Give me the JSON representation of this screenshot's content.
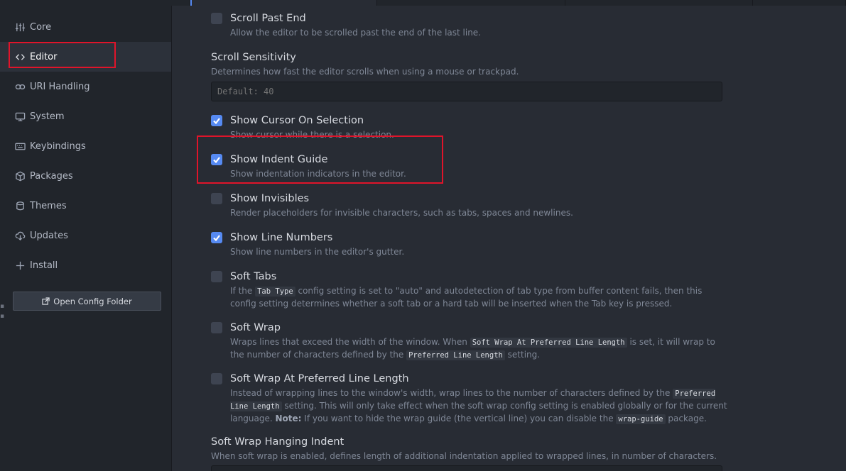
{
  "sidebar": {
    "items": [
      {
        "label": "Core",
        "icon": "sliders-icon"
      },
      {
        "label": "Editor",
        "icon": "code-icon"
      },
      {
        "label": "URI Handling",
        "icon": "link-icon"
      },
      {
        "label": "System",
        "icon": "monitor-icon"
      },
      {
        "label": "Keybindings",
        "icon": "keyboard-icon"
      },
      {
        "label": "Packages",
        "icon": "package-icon"
      },
      {
        "label": "Themes",
        "icon": "paintcan-icon"
      },
      {
        "label": "Updates",
        "icon": "cloud-download-icon"
      },
      {
        "label": "Install",
        "icon": "plus-icon"
      }
    ],
    "selected": "Editor",
    "open_config_label": "Open Config Folder"
  },
  "settings": {
    "scroll_past_end": {
      "title": "Scroll Past End",
      "desc": "Allow the editor to be scrolled past the end of the last line.",
      "checked": false
    },
    "scroll_sensitivity": {
      "title": "Scroll Sensitivity",
      "desc": "Determines how fast the editor scrolls when using a mouse or trackpad.",
      "placeholder": "Default: 40"
    },
    "show_cursor_on_selection": {
      "title": "Show Cursor On Selection",
      "desc": "Show cursor while there is a selection.",
      "checked": true
    },
    "show_indent_guide": {
      "title": "Show Indent Guide",
      "desc": "Show indentation indicators in the editor.",
      "checked": true
    },
    "show_invisibles": {
      "title": "Show Invisibles",
      "desc": "Render placeholders for invisible characters, such as tabs, spaces and newlines.",
      "checked": false
    },
    "show_line_numbers": {
      "title": "Show Line Numbers",
      "desc": "Show line numbers in the editor's gutter.",
      "checked": true
    },
    "soft_tabs": {
      "title": "Soft Tabs",
      "desc_1": "If the ",
      "code_1": "Tab Type",
      "desc_2": " config setting is set to \"auto\" and autodetection of tab type from buffer content fails, then this config setting determines whether a soft tab or a hard tab will be inserted when the Tab key is pressed.",
      "checked": false
    },
    "soft_wrap": {
      "title": "Soft Wrap",
      "desc_1": "Wraps lines that exceed the width of the window. When ",
      "code_1": "Soft Wrap At Preferred Line Length",
      "desc_2": " is set, it will wrap to the number of characters defined by the ",
      "code_2": "Preferred Line Length",
      "desc_3": " setting.",
      "checked": false
    },
    "soft_wrap_at_preferred": {
      "title": "Soft Wrap At Preferred Line Length",
      "desc_1": "Instead of wrapping lines to the window's width, wrap lines to the number of characters defined by the ",
      "code_1": "Preferred Line Length",
      "desc_2": " setting. This will only take effect when the soft wrap config setting is enabled globally or for the current language. ",
      "note_label": "Note:",
      "desc_3": " If you want to hide the wrap guide (the vertical line) you can disable the ",
      "code_2": "wrap-guide",
      "desc_4": " package.",
      "checked": false
    },
    "soft_wrap_hanging_indent": {
      "title": "Soft Wrap Hanging Indent",
      "desc": "When soft wrap is enabled, defines length of additional indentation applied to wrapped lines, in number of characters."
    }
  },
  "colors": {
    "accent": "#568af2",
    "highlight": "#e0142a",
    "background": "#282c34",
    "sidebar": "#21252b"
  }
}
